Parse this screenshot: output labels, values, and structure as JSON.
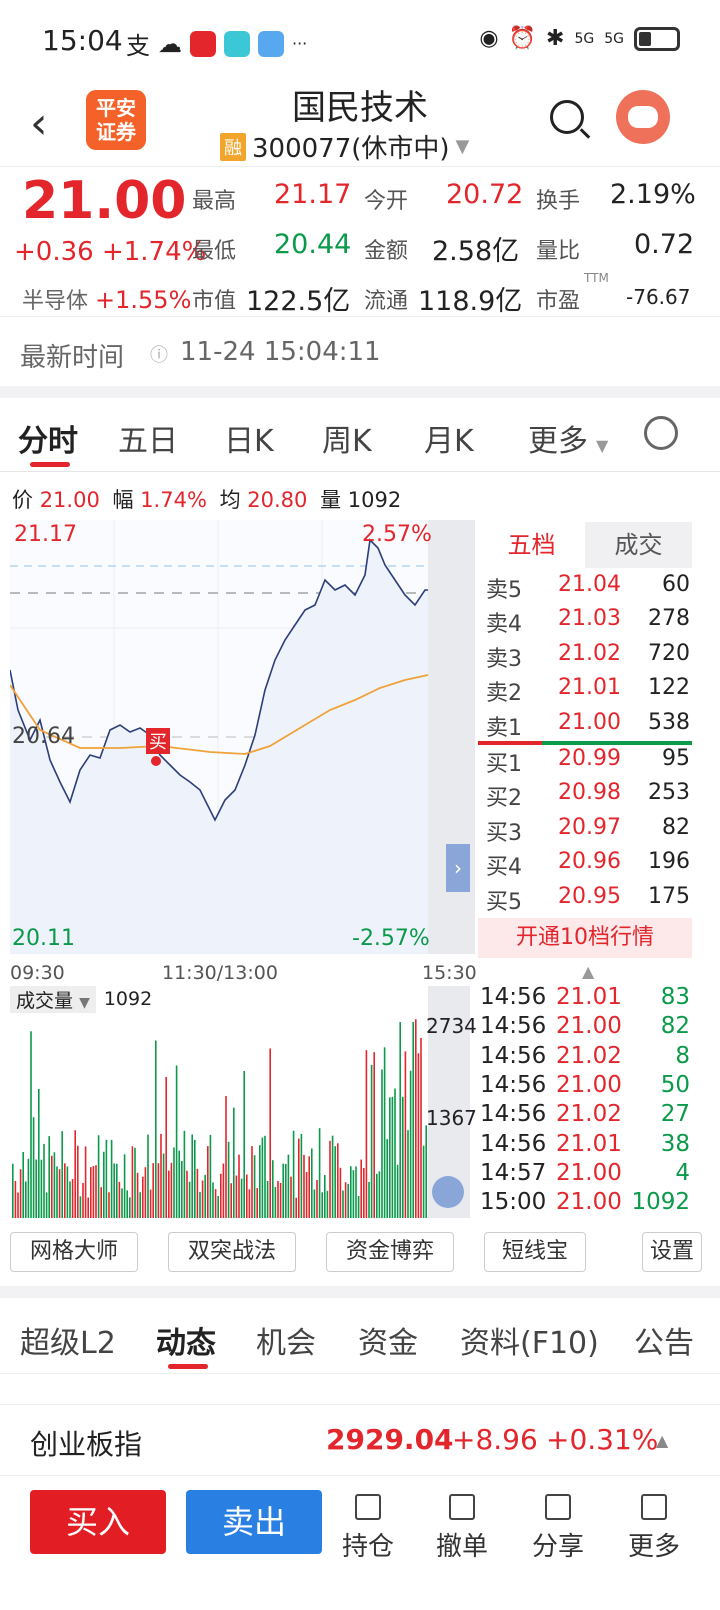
{
  "status": {
    "time": "15:04",
    "net1": "5G",
    "net2": "5G"
  },
  "header": {
    "back": "‹",
    "logo_text": "平安\n证券",
    "stock_name": "国民技术",
    "rong": "融",
    "code_status": "300077(休市中)"
  },
  "quote": {
    "price": "21.00",
    "change": "+0.36 +1.74%",
    "sector_name": "半导体",
    "sector_change": "+1.55%",
    "high_label": "最高",
    "high": "21.17",
    "open_label": "今开",
    "open": "20.72",
    "turnover_label": "换手",
    "turnover": "2.19%",
    "low_label": "最低",
    "low": "20.44",
    "amount_label": "金额",
    "amount": "2.58亿",
    "vol_ratio_label": "量比",
    "vol_ratio": "0.72",
    "mcap_label": "市值",
    "mcap": "122.5亿",
    "float_label": "流通",
    "float": "118.9亿",
    "pe_label": "市盈",
    "pe_sup": "TTM",
    "pe": "-76.67"
  },
  "latest": {
    "label": "最新时间",
    "value": "11-24 15:04:11"
  },
  "tabs": [
    "分时",
    "五日",
    "日K",
    "周K",
    "月K",
    "更多"
  ],
  "infoline": {
    "price_label": "价",
    "price": "21.00",
    "pct_label": "幅",
    "pct": "1.74%",
    "avg_label": "均",
    "avg": "20.80",
    "vol_label": "量",
    "vol": "1092"
  },
  "chart": {
    "top_price": "21.17",
    "top_pct": "2.57%",
    "mid_price": "20.64",
    "bottom_price": "20.11",
    "bottom_pct": "-2.57%",
    "buy_marker": "买",
    "time_start": "09:30",
    "time_mid": "11:30/13:00",
    "time_end": "15:30"
  },
  "volume": {
    "selector": "成交量",
    "value": "1092",
    "max": "2734",
    "mid": "1367"
  },
  "orderbook": {
    "tab1": "五档",
    "tab2": "成交",
    "asks": [
      {
        "label": "卖5",
        "price": "21.04",
        "qty": "60"
      },
      {
        "label": "卖4",
        "price": "21.03",
        "qty": "278"
      },
      {
        "label": "卖3",
        "price": "21.02",
        "qty": "720"
      },
      {
        "label": "卖2",
        "price": "21.01",
        "qty": "122"
      },
      {
        "label": "卖1",
        "price": "21.00",
        "qty": "538"
      }
    ],
    "bids": [
      {
        "label": "买1",
        "price": "20.99",
        "qty": "95"
      },
      {
        "label": "买2",
        "price": "20.98",
        "qty": "253"
      },
      {
        "label": "买3",
        "price": "20.97",
        "qty": "82"
      },
      {
        "label": "买4",
        "price": "20.96",
        "qty": "196"
      },
      {
        "label": "买5",
        "price": "20.95",
        "qty": "175"
      }
    ],
    "open10": "开通10档行情"
  },
  "ticks": [
    {
      "time": "14:56",
      "price": "21.01",
      "qty": "83"
    },
    {
      "time": "14:56",
      "price": "21.00",
      "qty": "82"
    },
    {
      "time": "14:56",
      "price": "21.02",
      "qty": "8"
    },
    {
      "time": "14:56",
      "price": "21.00",
      "qty": "50"
    },
    {
      "time": "14:56",
      "price": "21.02",
      "qty": "27"
    },
    {
      "time": "14:56",
      "price": "21.01",
      "qty": "38"
    },
    {
      "time": "14:57",
      "price": "21.00",
      "qty": "4"
    },
    {
      "time": "15:00",
      "price": "21.00",
      "qty": "1092"
    }
  ],
  "strategies": [
    "网格大师",
    "双突战法",
    "资金博弈",
    "短线宝",
    "设置"
  ],
  "ftabs": [
    "超级L2",
    "动态",
    "机会",
    "资金",
    "资料(F10)",
    "公告"
  ],
  "index": {
    "name": "创业板指",
    "value": "2929.04",
    "change": "+8.96",
    "pct": "+0.31%"
  },
  "bottom": {
    "buy": "买入",
    "sell": "卖出",
    "nav": [
      "持仓",
      "撤单",
      "分享",
      "更多"
    ]
  },
  "colors": {
    "up": "#e3262c",
    "down": "#0a9a4a",
    "buy": "#e31d24",
    "sell": "#2a7fe3"
  }
}
